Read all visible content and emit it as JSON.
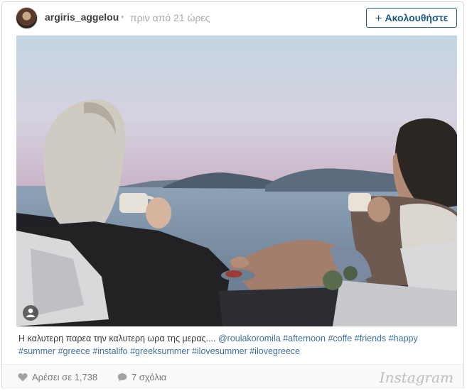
{
  "header": {
    "username": "argiris_aggelou",
    "separator": "•",
    "time": "πριν από 21 ώρες",
    "follow_icon": "plus-icon",
    "follow_label": "Ακολουθήστε"
  },
  "caption": {
    "text": "Η καλυτερη παρεα την καλυτερη ωρα της μερας....",
    "mention": "@roulakoromila",
    "hashtags": [
      "#afternoon",
      "#coffe",
      "#friends",
      "#happy",
      "#summer",
      "#greece",
      "#instalifo",
      "#greeksummer",
      "#ilovesummer",
      "#ilovegreece"
    ]
  },
  "footer": {
    "like_icon": "heart-icon",
    "likes_label": "Αρέσει σε 1,738",
    "comment_icon": "speech-bubble-icon",
    "comments_label": "7 σχόλια",
    "brand": "Instagram"
  },
  "colors": {
    "link": "#3f729b",
    "follow": "#1c5a88",
    "muted": "#a8a8a8"
  }
}
